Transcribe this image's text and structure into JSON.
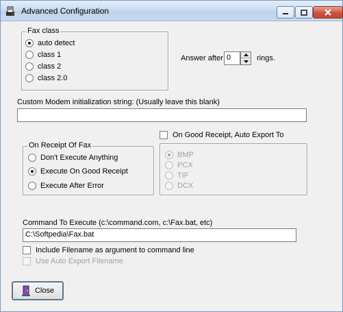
{
  "window": {
    "title": "Advanced Configuration"
  },
  "fax_class": {
    "label": "Fax class",
    "options": [
      "auto detect",
      "class 1",
      "class 2",
      "class 2.0"
    ],
    "selected": "auto detect"
  },
  "answer": {
    "prefix": "Answer after",
    "value": "0",
    "suffix": "rings."
  },
  "modem": {
    "label": "Custom Modem initialization string:  (Usually leave this blank)",
    "value": ""
  },
  "on_receipt": {
    "label": "On Receipt Of Fax",
    "options": [
      "Don't Execute Anything",
      "Execute On Good Receipt",
      "Execute After Error"
    ],
    "selected": "Execute On Good Receipt"
  },
  "auto_export": {
    "checkbox_label": "On Good Receipt, Auto Export To",
    "checked": false,
    "formats": [
      "BMP",
      "PCX",
      "TIF",
      "DCX"
    ],
    "selected": "BMP",
    "enabled": false
  },
  "command": {
    "label": "Command To Execute (c:\\command.com, c:\\Fax.bat, etc)",
    "value": "C:\\Softpedia\\Fax.bat"
  },
  "options": {
    "include_filename": "Include Filename as argument to command line",
    "use_auto_export": "Use Auto Export Filename"
  },
  "buttons": {
    "close": "Close"
  },
  "colors": {
    "titlebar": "#c9dbef",
    "close_button": "#c8553f",
    "window_bg": "#f0f0f0"
  }
}
